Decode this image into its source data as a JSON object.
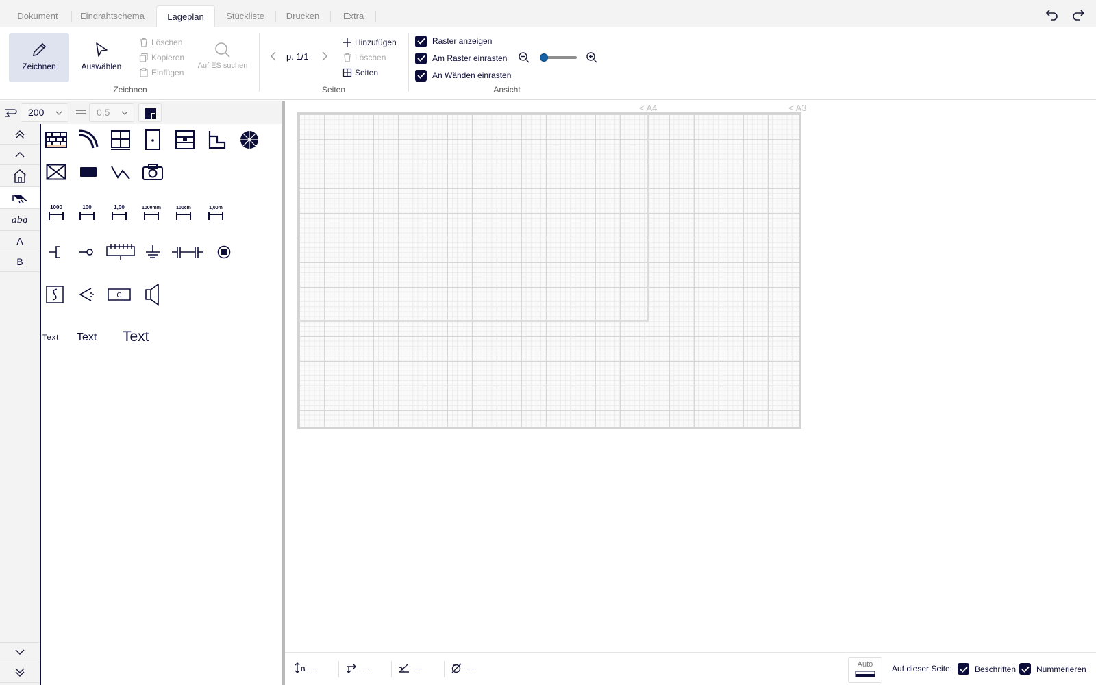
{
  "tabs": [
    "Dokument",
    "Eindrahtschema",
    "Lageplan",
    "Stückliste",
    "Drucken",
    "Extra"
  ],
  "active_tab": "Lageplan",
  "ribbon": {
    "zeichnen": {
      "draw_label": "Zeichnen",
      "select_label": "Auswählen",
      "delete_label": "Löschen",
      "copy_label": "Kopieren",
      "paste_label": "Einfügen",
      "search_label": "Auf ES suchen",
      "group_label": "Zeichnen"
    },
    "seiten": {
      "page_indicator": "p. 1/1",
      "add_label": "Hinzufügen",
      "delete_label": "Löschen",
      "pages_label": "Seiten",
      "group_label": "Seiten"
    },
    "ansicht": {
      "show_grid": "Raster anzeigen",
      "snap_grid": "Am Raster einrasten",
      "snap_walls": "An Wänden einrasten",
      "group_label": "Ansicht",
      "zoom_level": 0.0
    }
  },
  "panel": {
    "scale_value": "200",
    "line_width_value": "0.5",
    "categories": [
      "A",
      "B"
    ],
    "dimension_labels": [
      "1000",
      "100",
      "1,00",
      "1000mm",
      "100cm",
      "1,00m"
    ],
    "capacitor_label": "C",
    "text_samples": [
      "Text",
      "Text",
      "Text"
    ]
  },
  "canvas": {
    "paper_a4": "< A4",
    "paper_a3": "< A3"
  },
  "status": {
    "height_value": "---",
    "length_value": "---",
    "angle_value": "---",
    "diameter_value": "---",
    "auto_label": "Auto",
    "on_this_page": "Auf dieser Seite:",
    "labels_check": "Beschriften",
    "number_check": "Nummerieren"
  }
}
